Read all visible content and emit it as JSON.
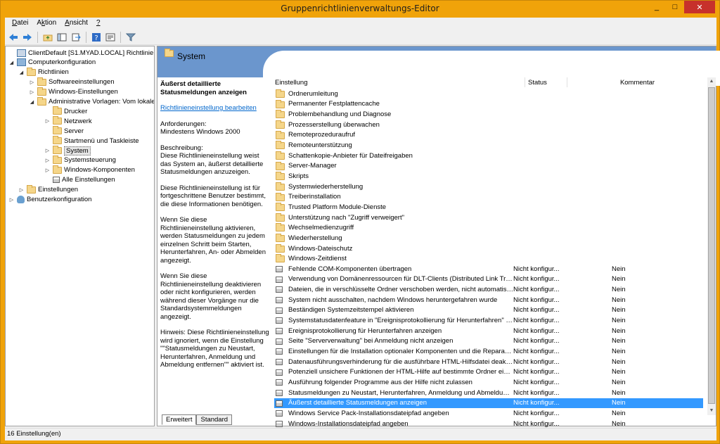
{
  "window": {
    "title": "Gruppenrichtlinienverwaltungs-Editor",
    "minimize": "_",
    "maximize": "□",
    "close": "✕"
  },
  "menu": {
    "items": [
      {
        "label": "Datei",
        "key": "D",
        "rest": "atei"
      },
      {
        "label": "Aktion",
        "key": "k",
        "pre": "A",
        "rest": "tion"
      },
      {
        "label": "Ansicht",
        "key": "A",
        "rest": "nsicht"
      },
      {
        "label": "?",
        "key": "?",
        "rest": ""
      }
    ]
  },
  "tree": {
    "items": [
      {
        "label": "ClientDefault [S1.MYAD.LOCAL] Richtlinie",
        "depth": 0,
        "twisty": "",
        "icon": "policy-icon"
      },
      {
        "label": "Computerkonfiguration",
        "depth": 0,
        "twisty": "◢",
        "icon": "computer-icon"
      },
      {
        "label": "Richtlinien",
        "depth": 1,
        "twisty": "◢",
        "icon": "folder-icon"
      },
      {
        "label": "Softwareeinstellungen",
        "depth": 2,
        "twisty": "▷",
        "icon": "folder-icon"
      },
      {
        "label": "Windows-Einstellungen",
        "depth": 2,
        "twisty": "▷",
        "icon": "folder-icon"
      },
      {
        "label": "Administrative Vorlagen: Vom lokalen",
        "depth": 2,
        "twisty": "◢",
        "icon": "folder-icon"
      },
      {
        "label": "Drucker",
        "depth": 3,
        "twisty": "",
        "icon": "folder-icon"
      },
      {
        "label": "Netzwerk",
        "depth": 3,
        "twisty": "▷",
        "icon": "folder-icon"
      },
      {
        "label": "Server",
        "depth": 3,
        "twisty": "",
        "icon": "folder-icon"
      },
      {
        "label": "Startmenü und Taskleiste",
        "depth": 3,
        "twisty": "",
        "icon": "folder-icon"
      },
      {
        "label": "System",
        "depth": 3,
        "twisty": "▷",
        "icon": "folder-icon",
        "selected": true
      },
      {
        "label": "Systemsteuerung",
        "depth": 3,
        "twisty": "▷",
        "icon": "folder-icon"
      },
      {
        "label": "Windows-Komponenten",
        "depth": 3,
        "twisty": "▷",
        "icon": "folder-icon"
      },
      {
        "label": "Alle Einstellungen",
        "depth": 3,
        "twisty": "",
        "icon": "settings-icon"
      },
      {
        "label": "Einstellungen",
        "depth": 1,
        "twisty": "▷",
        "icon": "folder-icon"
      },
      {
        "label": "Benutzerkonfiguration",
        "depth": 0,
        "twisty": "▷",
        "icon": "user-icon"
      }
    ]
  },
  "header": {
    "title": "System"
  },
  "description": {
    "title": "Äußerst detaillierte Statusmeldungen anzeigen",
    "edit_link": "Richtlinieneinstellung bearbeiten",
    "requirements_label": "Anforderungen:",
    "requirements_value": "Mindestens Windows 2000",
    "description_label": "Beschreibung:",
    "paragraphs": [
      "Diese Richtlinieneinstellung weist das System an, äußerst detaillierte Statusmeldungen anzuzeigen.",
      "Diese Richtlinieneinstellung ist für fortgeschrittene Benutzer bestimmt, die diese Informationen benötigen.",
      "Wenn Sie diese Richtlinieneinstellung aktivieren, werden Statusmeldungen zu jedem einzelnen Schritt beim Starten, Herunterfahren, An- oder Abmelden angezeigt.",
      "Wenn Sie diese Richtlinieneinstellung deaktivieren oder nicht konfigurieren, werden während dieser Vorgänge nur die Standardsystemmeldungen angezeigt.",
      "Hinweis: Diese Richtlinieneinstellung wird ignoriert, wenn die Einstellung \"\"Statusmeldungen zu Neustart, Herunterfahren, Anmeldung und Abmeldung entfernen\"\" aktiviert ist."
    ]
  },
  "columns": {
    "name": "Einstellung",
    "status": "Status",
    "comment": "Kommentar"
  },
  "rows": [
    {
      "name": "Ordnerumleitung",
      "status": "",
      "comment": "",
      "type": "folder"
    },
    {
      "name": "Permanenter Festplattencache",
      "status": "",
      "comment": "",
      "type": "folder"
    },
    {
      "name": "Problembehandlung und Diagnose",
      "status": "",
      "comment": "",
      "type": "folder"
    },
    {
      "name": "Prozesserstellung überwachen",
      "status": "",
      "comment": "",
      "type": "folder"
    },
    {
      "name": "Remoteprozeduraufruf",
      "status": "",
      "comment": "",
      "type": "folder"
    },
    {
      "name": "Remoteunterstützung",
      "status": "",
      "comment": "",
      "type": "folder"
    },
    {
      "name": "Schattenkopie-Anbieter für Dateifreigaben",
      "status": "",
      "comment": "",
      "type": "folder"
    },
    {
      "name": "Server-Manager",
      "status": "",
      "comment": "",
      "type": "folder"
    },
    {
      "name": "Skripts",
      "status": "",
      "comment": "",
      "type": "folder"
    },
    {
      "name": "Systemwiederherstellung",
      "status": "",
      "comment": "",
      "type": "folder"
    },
    {
      "name": "Treiberinstallation",
      "status": "",
      "comment": "",
      "type": "folder"
    },
    {
      "name": "Trusted Platform Module-Dienste",
      "status": "",
      "comment": "",
      "type": "folder"
    },
    {
      "name": "Unterstützung nach \"Zugriff verweigert\"",
      "status": "",
      "comment": "",
      "type": "folder"
    },
    {
      "name": "Wechselmedienzugriff",
      "status": "",
      "comment": "",
      "type": "folder"
    },
    {
      "name": "Wiederherstellung",
      "status": "",
      "comment": "",
      "type": "folder"
    },
    {
      "name": "Windows-Dateischutz",
      "status": "",
      "comment": "",
      "type": "folder"
    },
    {
      "name": "Windows-Zeitdienst",
      "status": "",
      "comment": "",
      "type": "folder"
    },
    {
      "name": "Fehlende COM-Komponenten übertragen",
      "status": "Nicht konfigur...",
      "comment": "Nein",
      "type": "setting"
    },
    {
      "name": "Verwendung von Domänenressourcen für DLT-Clients (Distributed Link Trac...",
      "status": "Nicht konfigur...",
      "comment": "Nein",
      "type": "setting"
    },
    {
      "name": "Dateien, die in verschlüsselte Ordner verschoben werden, nicht automatisch ...",
      "status": "Nicht konfigur...",
      "comment": "Nein",
      "type": "setting"
    },
    {
      "name": "System nicht ausschalten, nachdem Windows heruntergefahren wurde",
      "status": "Nicht konfigur...",
      "comment": "Nein",
      "type": "setting"
    },
    {
      "name": "Beständigen Systemzeitstempel aktivieren",
      "status": "Nicht konfigur...",
      "comment": "Nein",
      "type": "setting"
    },
    {
      "name": "Systemstatusdatenfeature in \"Ereignisprotokollierung für Herunterfahren\" ak...",
      "status": "Nicht konfigur...",
      "comment": "Nein",
      "type": "setting"
    },
    {
      "name": "Ereignisprotokollierung für Herunterfahren anzeigen",
      "status": "Nicht konfigur...",
      "comment": "Nein",
      "type": "setting"
    },
    {
      "name": "Seite \"Serververwaltung\" bei Anmeldung nicht anzeigen",
      "status": "Nicht konfigur...",
      "comment": "Nein",
      "type": "setting"
    },
    {
      "name": "Einstellungen für die Installation optionaler Komponenten und die Reparatur...",
      "status": "Nicht konfigur...",
      "comment": "Nein",
      "type": "setting"
    },
    {
      "name": "Datenausführungsverhinderung für die ausführbare HTML-Hilfsdatei deakti...",
      "status": "Nicht konfigur...",
      "comment": "Nein",
      "type": "setting"
    },
    {
      "name": "Potenziell unsichere Funktionen der HTML-Hilfe auf bestimmte Ordner eins...",
      "status": "Nicht konfigur...",
      "comment": "Nein",
      "type": "setting"
    },
    {
      "name": "Ausführung folgender Programme aus der Hilfe nicht zulassen",
      "status": "Nicht konfigur...",
      "comment": "Nein",
      "type": "setting"
    },
    {
      "name": "Statusmeldungen zu Neustart, Herunterfahren, Anmeldung und Abmeldung...",
      "status": "Nicht konfigur...",
      "comment": "Nein",
      "type": "setting"
    },
    {
      "name": "Äußerst detaillierte Statusmeldungen anzeigen",
      "status": "Nicht konfigur...",
      "comment": "Nein",
      "type": "setting",
      "selected": true
    },
    {
      "name": "Windows Service Pack-Installationsdateipfad angeben",
      "status": "Nicht konfigur...",
      "comment": "Nein",
      "type": "setting"
    },
    {
      "name": "Windows-Installationsdateipfad angeben",
      "status": "Nicht konfigur...",
      "comment": "Nein",
      "type": "setting"
    }
  ],
  "tabs": [
    {
      "label": "Erweitert",
      "active": true
    },
    {
      "label": "Standard",
      "active": false
    }
  ],
  "status": {
    "text": "16 Einstellung(en)"
  }
}
